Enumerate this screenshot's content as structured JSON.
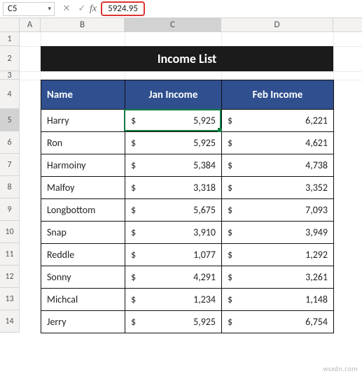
{
  "formula_bar": {
    "cell_ref": "C5",
    "value": "5924.95",
    "fx_label": "fx"
  },
  "columns": [
    "A",
    "B",
    "C",
    "D"
  ],
  "row_numbers": [
    1,
    2,
    3,
    4,
    5,
    6,
    7,
    8,
    9,
    10,
    11,
    12,
    13,
    14
  ],
  "selected_cell": "C5",
  "title": "Income List",
  "headers": {
    "name": "Name",
    "jan": "Jan Income",
    "feb": "Feb Income"
  },
  "currency": "$",
  "rows": [
    {
      "name": "Harry",
      "jan": "5,925",
      "feb": "6,221"
    },
    {
      "name": "Ron",
      "jan": "5,925",
      "feb": "4,621"
    },
    {
      "name": "Harmoiny",
      "jan": "5,384",
      "feb": "4,738"
    },
    {
      "name": "Malfoy",
      "jan": "3,318",
      "feb": "3,352"
    },
    {
      "name": "Longbottom",
      "jan": "5,675",
      "feb": "7,093"
    },
    {
      "name": "Snap",
      "jan": "3,910",
      "feb": "3,949"
    },
    {
      "name": "Reddle",
      "jan": "1,077",
      "feb": "1,292"
    },
    {
      "name": "Sonny",
      "jan": "4,291",
      "feb": "3,261"
    },
    {
      "name": "Michcal",
      "jan": "1,234",
      "feb": "1,148"
    },
    {
      "name": "Jerry",
      "jan": "5,925",
      "feb": "6,754"
    }
  ],
  "watermark": "wsxdn.com",
  "chart_data": {
    "type": "table",
    "title": "Income List",
    "columns": [
      "Name",
      "Jan Income",
      "Feb Income"
    ],
    "data": [
      [
        "Harry",
        5925,
        6221
      ],
      [
        "Ron",
        5925,
        4621
      ],
      [
        "Harmoiny",
        5384,
        4738
      ],
      [
        "Malfoy",
        3318,
        3352
      ],
      [
        "Longbottom",
        5675,
        7093
      ],
      [
        "Snap",
        3910,
        3949
      ],
      [
        "Reddle",
        1077,
        1292
      ],
      [
        "Sonny",
        4291,
        3261
      ],
      [
        "Michcal",
        1234,
        1148
      ],
      [
        "Jerry",
        5925,
        6754
      ]
    ]
  }
}
